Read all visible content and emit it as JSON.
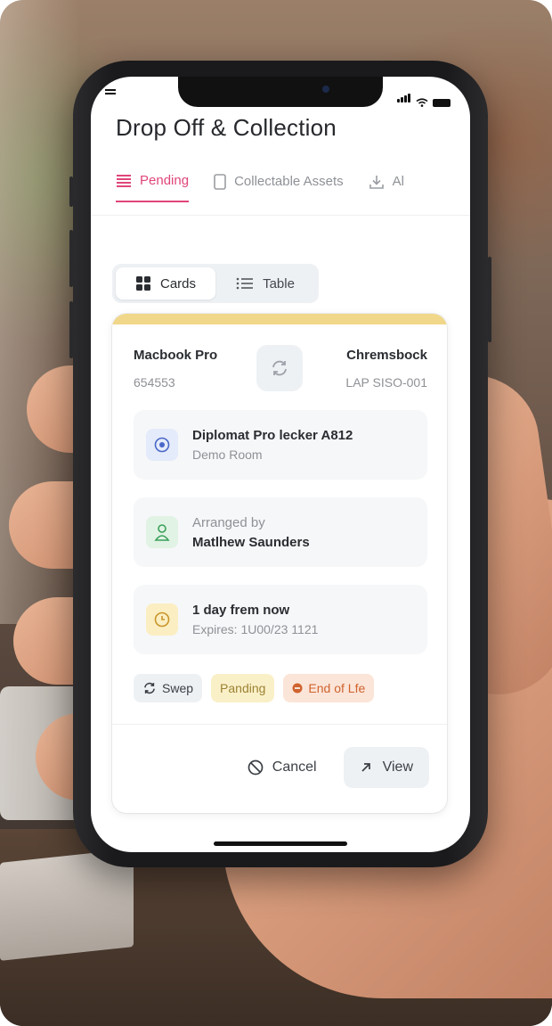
{
  "app": {
    "title": "Drop Off & Collection"
  },
  "tabs": [
    {
      "label": "Pending",
      "icon": "list-icon",
      "active": true
    },
    {
      "label": "Collectable Assets",
      "icon": "tablet-icon",
      "active": false
    },
    {
      "label": "Al",
      "icon": "download-icon",
      "active": false
    }
  ],
  "view_toggle": {
    "cards_label": "Cards",
    "table_label": "Table",
    "selected": "Cards"
  },
  "card": {
    "from_asset": {
      "name": "Macbook Pro",
      "id": "654553"
    },
    "to_asset": {
      "name": "Chremsbock",
      "id": "LAP SISO-001"
    },
    "location": {
      "title": "Diplomat Pro lecker A812",
      "subtitle": "Demo Room"
    },
    "arranged": {
      "prefix": "Arranged by",
      "name": "Matlhew Saunders"
    },
    "expiry": {
      "title": "1 day frem now",
      "subtitle": "Expires: 1U00/23 1121"
    },
    "badges": {
      "swap": "Swep",
      "pending": "Panding",
      "eol": "End of Lfe"
    },
    "actions": {
      "cancel": "Cancel",
      "view": "View"
    }
  },
  "colors": {
    "accent_pink": "#e0457b",
    "card_accent_yellow": "#f1d78a",
    "location_icon_bg": "#e4ebfa",
    "person_icon_bg": "#e1f3e4",
    "clock_icon_bg": "#fbeec2",
    "eol_red": "#d0632f"
  }
}
